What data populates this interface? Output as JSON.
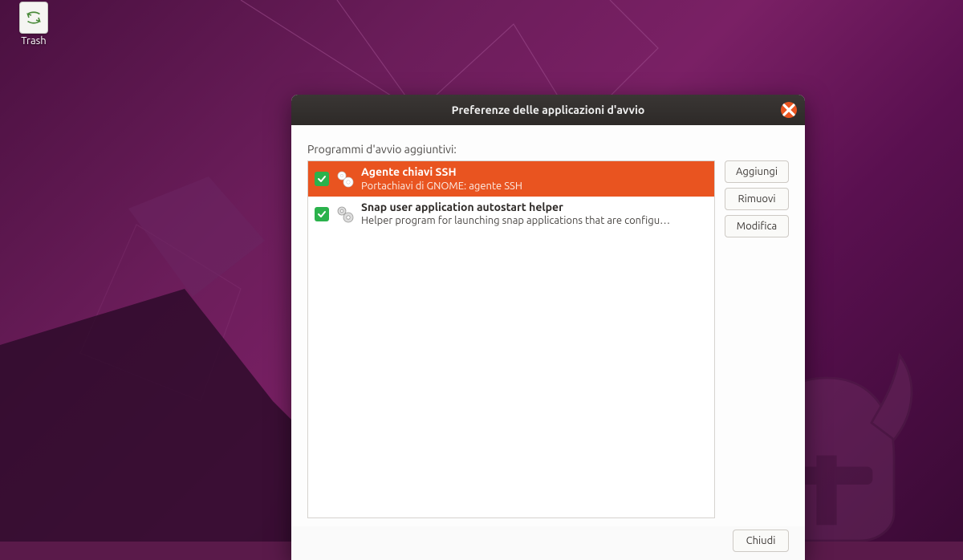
{
  "desktop": {
    "trash_label": "Trash"
  },
  "dialog": {
    "title": "Preferenze delle applicazioni d'avvio",
    "section_label": "Programmi d'avvio aggiuntivi:",
    "items": [
      {
        "checked": true,
        "selected": true,
        "title": "Agente chiavi SSH",
        "description": "Portachiavi di GNOME: agente SSH"
      },
      {
        "checked": true,
        "selected": false,
        "title": "Snap user application autostart helper",
        "description": "Helper program for launching snap applications that are configu…"
      }
    ],
    "buttons": {
      "add": "Aggiungi",
      "remove": "Rimuovi",
      "edit": "Modifica",
      "close": "Chiudi"
    }
  },
  "colors": {
    "accent": "#e95420",
    "check_green": "#2bb24c"
  }
}
